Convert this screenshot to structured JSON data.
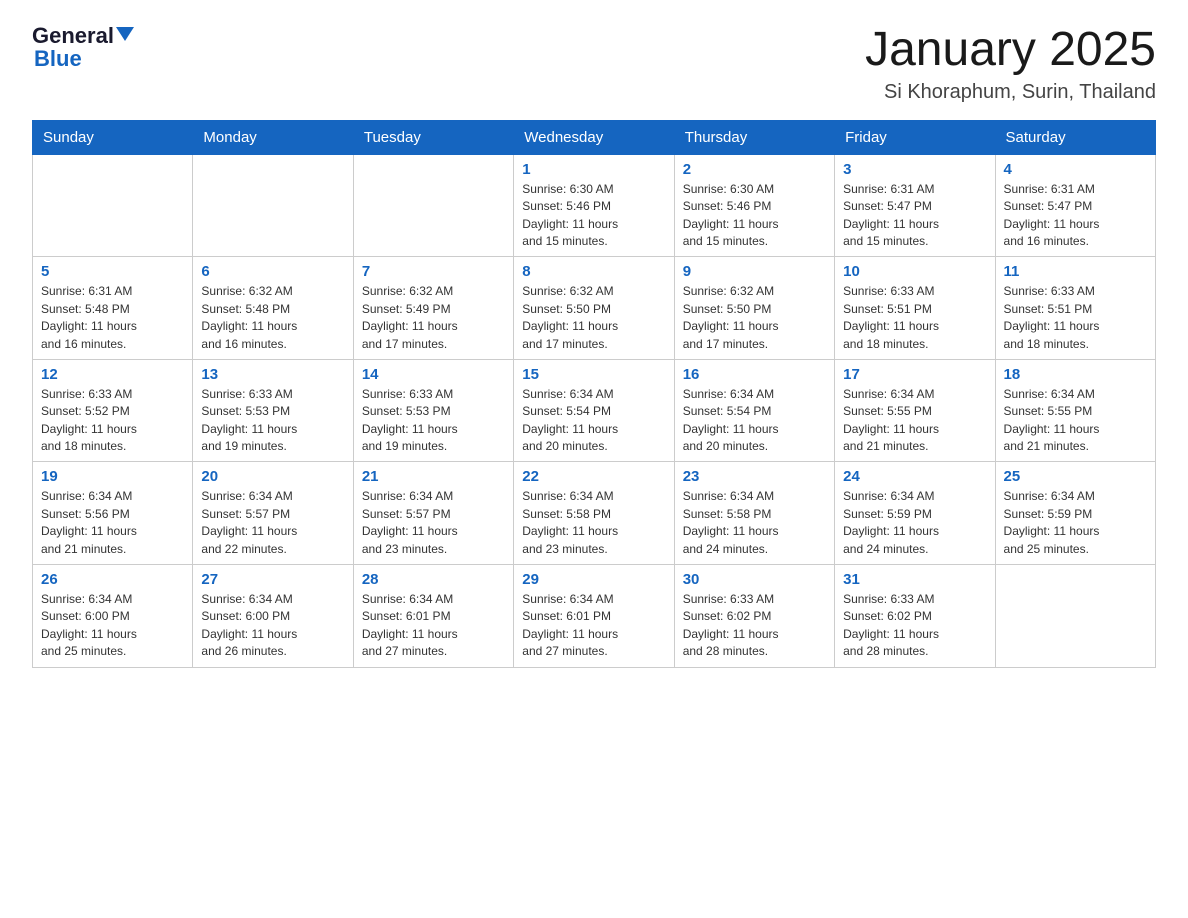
{
  "logo": {
    "general": "General",
    "blue": "Blue"
  },
  "title": "January 2025",
  "subtitle": "Si Khoraphum, Surin, Thailand",
  "headers": [
    "Sunday",
    "Monday",
    "Tuesday",
    "Wednesday",
    "Thursday",
    "Friday",
    "Saturday"
  ],
  "weeks": [
    [
      {
        "day": "",
        "info": ""
      },
      {
        "day": "",
        "info": ""
      },
      {
        "day": "",
        "info": ""
      },
      {
        "day": "1",
        "info": "Sunrise: 6:30 AM\nSunset: 5:46 PM\nDaylight: 11 hours\nand 15 minutes."
      },
      {
        "day": "2",
        "info": "Sunrise: 6:30 AM\nSunset: 5:46 PM\nDaylight: 11 hours\nand 15 minutes."
      },
      {
        "day": "3",
        "info": "Sunrise: 6:31 AM\nSunset: 5:47 PM\nDaylight: 11 hours\nand 15 minutes."
      },
      {
        "day": "4",
        "info": "Sunrise: 6:31 AM\nSunset: 5:47 PM\nDaylight: 11 hours\nand 16 minutes."
      }
    ],
    [
      {
        "day": "5",
        "info": "Sunrise: 6:31 AM\nSunset: 5:48 PM\nDaylight: 11 hours\nand 16 minutes."
      },
      {
        "day": "6",
        "info": "Sunrise: 6:32 AM\nSunset: 5:48 PM\nDaylight: 11 hours\nand 16 minutes."
      },
      {
        "day": "7",
        "info": "Sunrise: 6:32 AM\nSunset: 5:49 PM\nDaylight: 11 hours\nand 17 minutes."
      },
      {
        "day": "8",
        "info": "Sunrise: 6:32 AM\nSunset: 5:50 PM\nDaylight: 11 hours\nand 17 minutes."
      },
      {
        "day": "9",
        "info": "Sunrise: 6:32 AM\nSunset: 5:50 PM\nDaylight: 11 hours\nand 17 minutes."
      },
      {
        "day": "10",
        "info": "Sunrise: 6:33 AM\nSunset: 5:51 PM\nDaylight: 11 hours\nand 18 minutes."
      },
      {
        "day": "11",
        "info": "Sunrise: 6:33 AM\nSunset: 5:51 PM\nDaylight: 11 hours\nand 18 minutes."
      }
    ],
    [
      {
        "day": "12",
        "info": "Sunrise: 6:33 AM\nSunset: 5:52 PM\nDaylight: 11 hours\nand 18 minutes."
      },
      {
        "day": "13",
        "info": "Sunrise: 6:33 AM\nSunset: 5:53 PM\nDaylight: 11 hours\nand 19 minutes."
      },
      {
        "day": "14",
        "info": "Sunrise: 6:33 AM\nSunset: 5:53 PM\nDaylight: 11 hours\nand 19 minutes."
      },
      {
        "day": "15",
        "info": "Sunrise: 6:34 AM\nSunset: 5:54 PM\nDaylight: 11 hours\nand 20 minutes."
      },
      {
        "day": "16",
        "info": "Sunrise: 6:34 AM\nSunset: 5:54 PM\nDaylight: 11 hours\nand 20 minutes."
      },
      {
        "day": "17",
        "info": "Sunrise: 6:34 AM\nSunset: 5:55 PM\nDaylight: 11 hours\nand 21 minutes."
      },
      {
        "day": "18",
        "info": "Sunrise: 6:34 AM\nSunset: 5:55 PM\nDaylight: 11 hours\nand 21 minutes."
      }
    ],
    [
      {
        "day": "19",
        "info": "Sunrise: 6:34 AM\nSunset: 5:56 PM\nDaylight: 11 hours\nand 21 minutes."
      },
      {
        "day": "20",
        "info": "Sunrise: 6:34 AM\nSunset: 5:57 PM\nDaylight: 11 hours\nand 22 minutes."
      },
      {
        "day": "21",
        "info": "Sunrise: 6:34 AM\nSunset: 5:57 PM\nDaylight: 11 hours\nand 23 minutes."
      },
      {
        "day": "22",
        "info": "Sunrise: 6:34 AM\nSunset: 5:58 PM\nDaylight: 11 hours\nand 23 minutes."
      },
      {
        "day": "23",
        "info": "Sunrise: 6:34 AM\nSunset: 5:58 PM\nDaylight: 11 hours\nand 24 minutes."
      },
      {
        "day": "24",
        "info": "Sunrise: 6:34 AM\nSunset: 5:59 PM\nDaylight: 11 hours\nand 24 minutes."
      },
      {
        "day": "25",
        "info": "Sunrise: 6:34 AM\nSunset: 5:59 PM\nDaylight: 11 hours\nand 25 minutes."
      }
    ],
    [
      {
        "day": "26",
        "info": "Sunrise: 6:34 AM\nSunset: 6:00 PM\nDaylight: 11 hours\nand 25 minutes."
      },
      {
        "day": "27",
        "info": "Sunrise: 6:34 AM\nSunset: 6:00 PM\nDaylight: 11 hours\nand 26 minutes."
      },
      {
        "day": "28",
        "info": "Sunrise: 6:34 AM\nSunset: 6:01 PM\nDaylight: 11 hours\nand 27 minutes."
      },
      {
        "day": "29",
        "info": "Sunrise: 6:34 AM\nSunset: 6:01 PM\nDaylight: 11 hours\nand 27 minutes."
      },
      {
        "day": "30",
        "info": "Sunrise: 6:33 AM\nSunset: 6:02 PM\nDaylight: 11 hours\nand 28 minutes."
      },
      {
        "day": "31",
        "info": "Sunrise: 6:33 AM\nSunset: 6:02 PM\nDaylight: 11 hours\nand 28 minutes."
      },
      {
        "day": "",
        "info": ""
      }
    ]
  ]
}
